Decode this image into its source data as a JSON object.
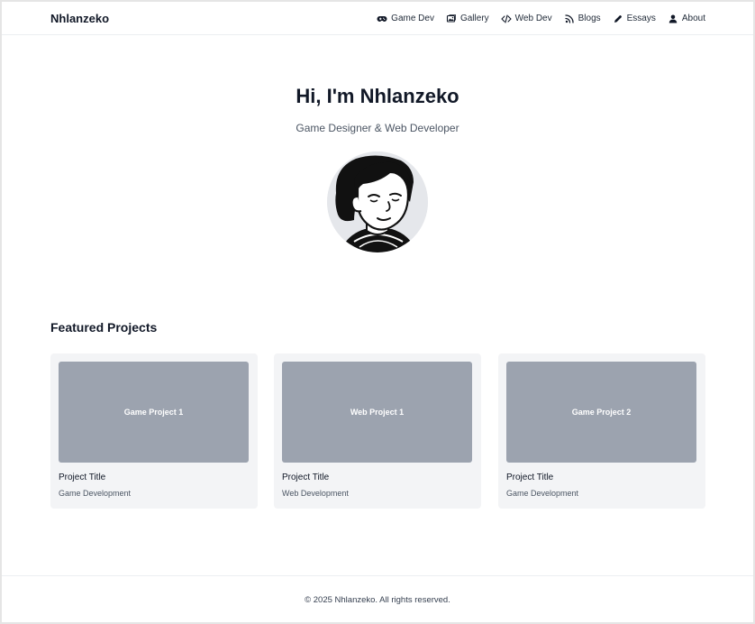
{
  "header": {
    "brand": "Nhlanzeko",
    "nav": [
      {
        "label": "Game Dev",
        "icon": "gamepad-icon"
      },
      {
        "label": "Gallery",
        "icon": "image-icon"
      },
      {
        "label": "Web Dev",
        "icon": "code-icon"
      },
      {
        "label": "Blogs",
        "icon": "rss-icon"
      },
      {
        "label": "Essays",
        "icon": "pencil-icon"
      },
      {
        "label": "About",
        "icon": "user-icon"
      }
    ]
  },
  "hero": {
    "title": "Hi, I'm Nhlanzeko",
    "subtitle": "Game Designer & Web Developer"
  },
  "projects": {
    "heading": "Featured Projects",
    "items": [
      {
        "thumb_label": "Game Project 1",
        "title": "Project Title",
        "category": "Game Development"
      },
      {
        "thumb_label": "Web Project 1",
        "title": "Project Title",
        "category": "Web Development"
      },
      {
        "thumb_label": "Game Project 2",
        "title": "Project Title",
        "category": "Game Development"
      }
    ]
  },
  "footer": {
    "text": "© 2025 Nhlanzeko. All rights reserved."
  },
  "colors": {
    "thumb": "#9ca3af",
    "card": "#f3f4f6",
    "avatar_bg": "#e5e7eb"
  }
}
